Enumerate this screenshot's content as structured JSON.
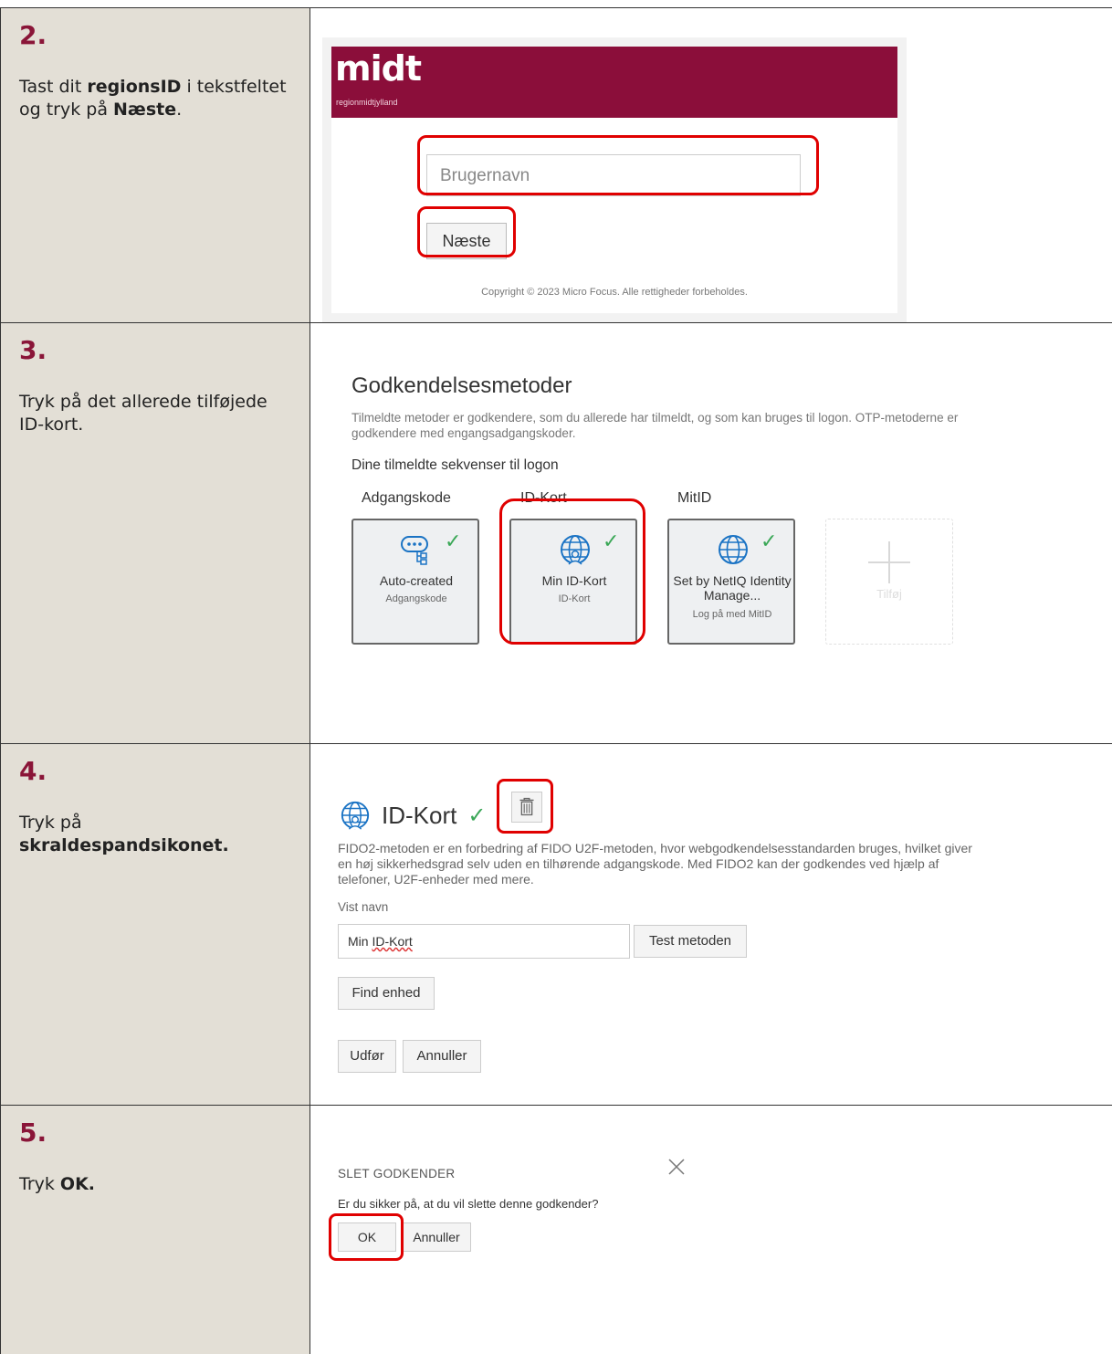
{
  "steps": [
    {
      "number": "2.",
      "text": {
        "before": "Tast dit ",
        "bold": "regionsID",
        "middle": " i tekstfeltet og tryk på ",
        "bold2": "Næste",
        "after": "."
      },
      "login": {
        "logo": "midt",
        "logo_sub": "regionmidtjylland",
        "username_placeholder": "Brugernavn",
        "next_label": "Næste",
        "copyright": "Copyright © 2023 Micro Focus. Alle rettigheder forbeholdes."
      }
    },
    {
      "number": "3.",
      "text": "Tryk på det allerede tilføjede ID-kort.",
      "methods": {
        "title": "Godkendelsesmetoder",
        "description": "Tilmeldte metoder er godkendere, som du allerede har tilmeldt, og som kan bruges til logon. OTP-metoderne er godkendere med engangsadgangskoder.",
        "sequence_heading": "Dine tilmeldte sekvenser til logon",
        "tiles": [
          {
            "category": "Adgangskode",
            "name": "Auto-created",
            "sub": "Adgangskode",
            "icon": "password-icon"
          },
          {
            "category": "ID-Kort",
            "name": "Min ID-Kort",
            "sub": "ID-Kort",
            "icon": "globe-user-icon"
          },
          {
            "category": "MitID",
            "name": "Set by NetIQ Identity Manage...",
            "sub": "Log på med MitID",
            "icon": "globe-icon"
          }
        ],
        "add_label": "Tilføj"
      }
    },
    {
      "number": "4.",
      "text": {
        "before": "Tryk på ",
        "bold": "skraldespandsikonet."
      },
      "detail": {
        "title": "ID-Kort",
        "description": "FIDO2-metoden er en forbedring af FIDO U2F-metoden, hvor webgodkendelsesstandarden bruges, hvilket giver en høj sikkerhedsgrad selv uden en tilhørende adgangskode. Med FIDO2 kan der godkendes ved hjælp af telefoner, U2F-enheder med mere.",
        "display_name_label": "Vist navn",
        "display_name_prefix": "Min ",
        "display_name_value": "ID-Kort",
        "test_label": "Test metoden",
        "find_label": "Find enhed",
        "execute_label": "Udfør",
        "cancel_label": "Annuller"
      }
    },
    {
      "number": "5.",
      "text": {
        "before": "Tryk ",
        "bold": "OK."
      },
      "dialog": {
        "title": "SLET GODKENDER",
        "question": "Er du sikker på, at du vil slette denne godkender?",
        "ok_label": "OK",
        "cancel_label": "Annuller"
      }
    }
  ],
  "colors": {
    "brand": "#8b0e3a",
    "highlight": "#e00000",
    "check": "#3aa757",
    "step_panel": "#e3dfd6"
  }
}
